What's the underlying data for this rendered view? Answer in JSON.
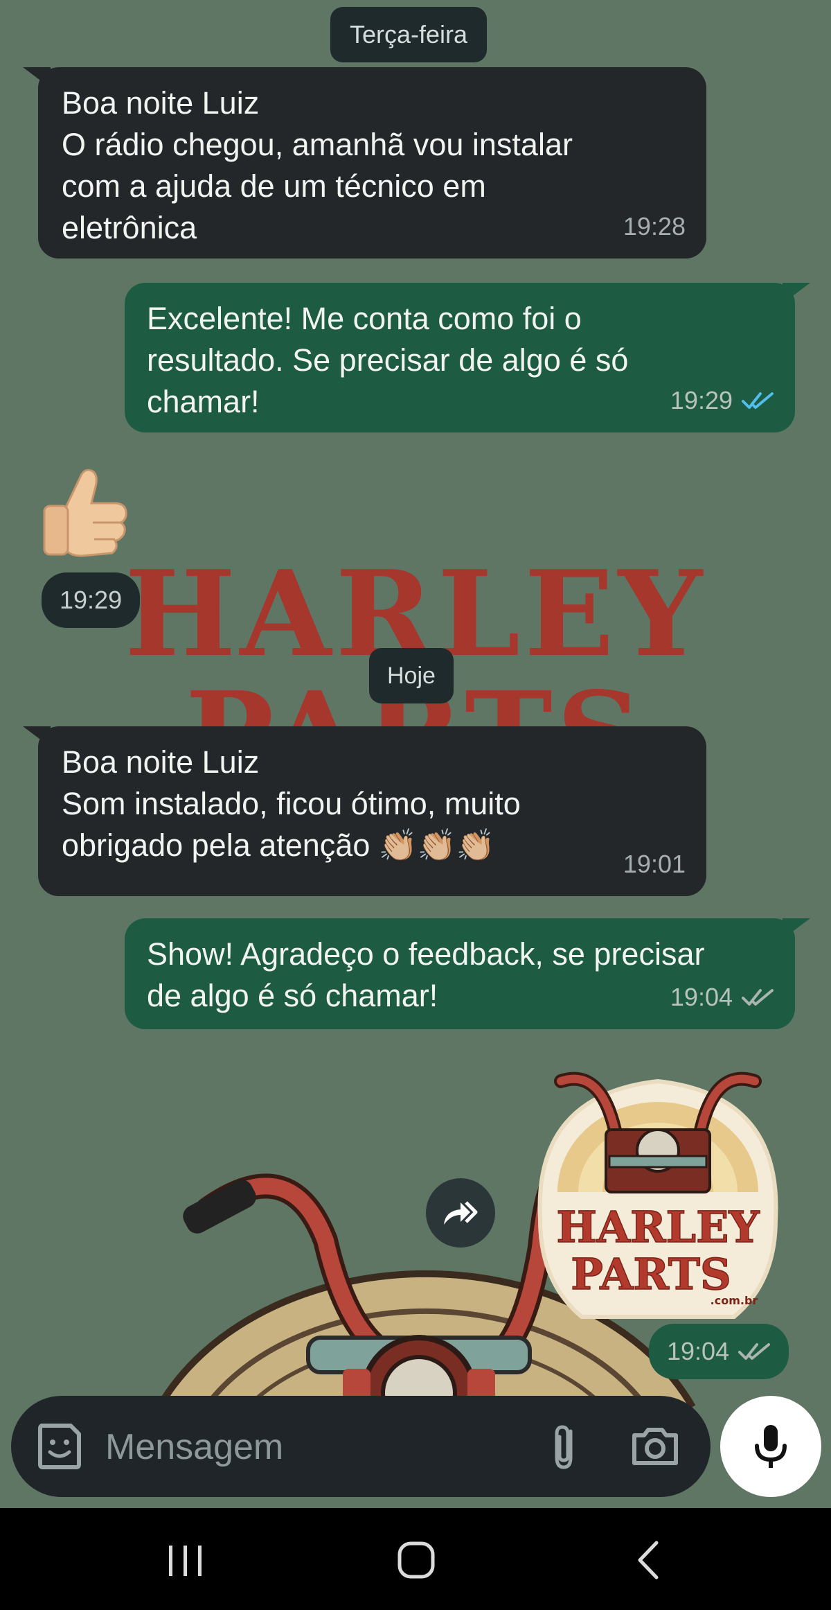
{
  "chat": {
    "day_labels": {
      "tuesday": "Terça-feira",
      "today": "Hoje"
    },
    "messages": [
      {
        "direction": "incoming",
        "text": "Boa noite Luiz\nO rádio chegou, amanhã vou instalar\ncom a ajuda de um técnico em\neletrônica",
        "time": "19:28"
      },
      {
        "direction": "outgoing",
        "text": "Excelente! Me conta como foi o\nresultado. Se precisar de algo é só\nchamar!",
        "time": "19:29",
        "status": "read"
      },
      {
        "direction": "incoming",
        "type": "emoji",
        "emoji": "thumbs-up",
        "time": "19:29"
      },
      {
        "direction": "incoming",
        "text": "Boa noite Luiz\nSom instalado, ficou ótimo, muito\nobrigado pela atenção 👏🏼👏🏼👏🏼",
        "time": "19:01"
      },
      {
        "direction": "outgoing",
        "text": "Show! Agradeço o feedback, se precisar\nde algo é só chamar!",
        "time": "19:04",
        "status": "delivered"
      },
      {
        "direction": "outgoing",
        "type": "sticker",
        "sticker_text": {
          "line1": "HARLEY",
          "line2": "PARTS",
          "domain": ".com.br"
        },
        "time": "19:04",
        "status": "delivered"
      }
    ]
  },
  "wallpaper_text": {
    "line1": "HARLEY",
    "line2": "PARTS"
  },
  "composer": {
    "placeholder": "Mensagem"
  },
  "icons": {
    "emoji_button": "sticker-smile-icon",
    "attach": "paperclip-icon",
    "camera": "camera-icon",
    "mic": "microphone-icon",
    "forward": "forward-icon",
    "read_status": "double-check-icon"
  },
  "colors": {
    "background": "#5f7665",
    "incoming_bubble": "#232729",
    "outgoing_bubble": "#1d5b42",
    "read_tick": "#53bdeb",
    "delivered_tick": "#aab5b0",
    "brand_red": "#a5372c"
  },
  "navigation": {
    "buttons": [
      "recents",
      "home",
      "back"
    ]
  }
}
